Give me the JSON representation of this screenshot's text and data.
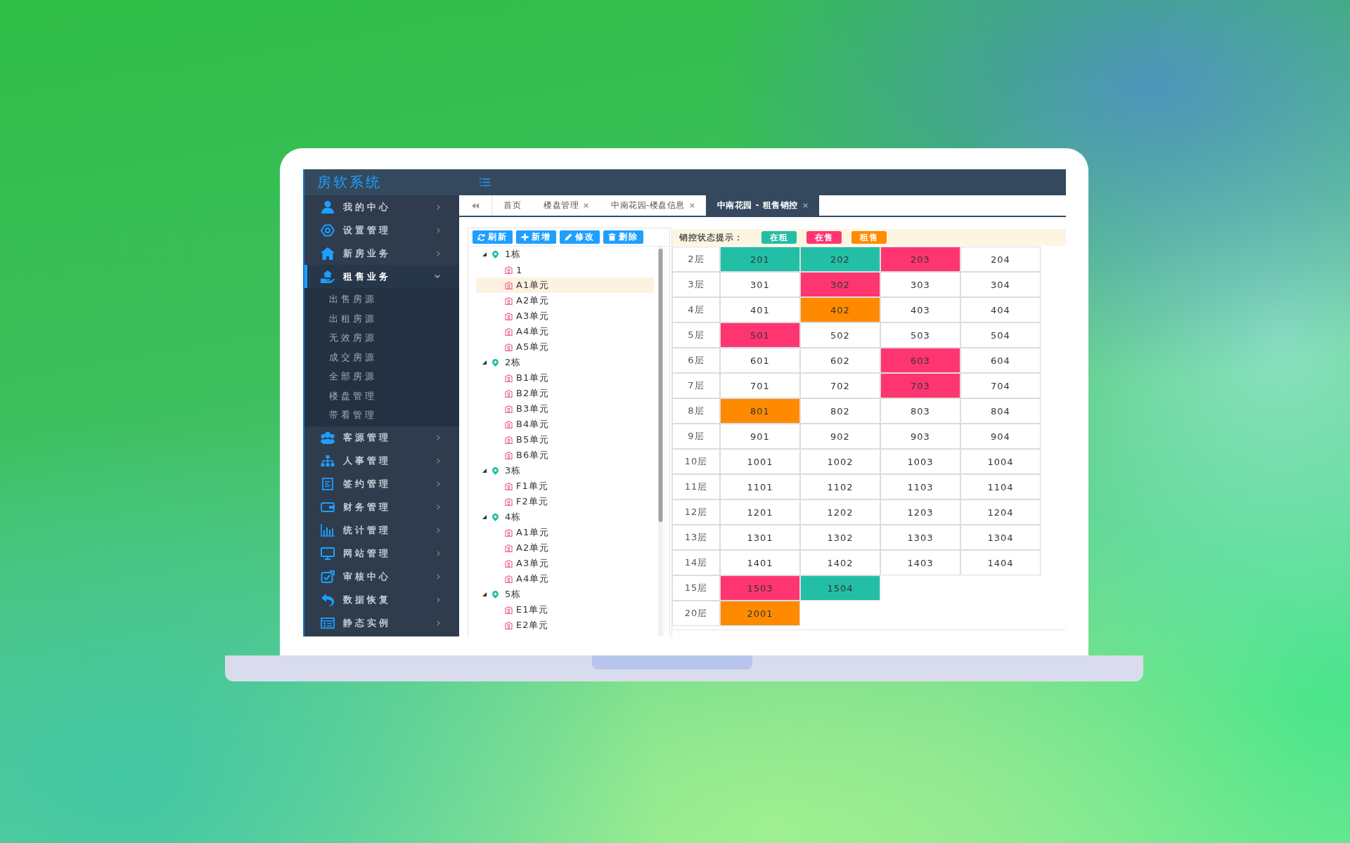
{
  "header": {
    "title": "房软系统"
  },
  "sidebar": {
    "items": [
      {
        "label": "我的中心",
        "selected": false,
        "expanded": false
      },
      {
        "label": "设置管理",
        "selected": false,
        "expanded": false
      },
      {
        "label": "新房业务",
        "selected": false,
        "expanded": false
      },
      {
        "label": "租售业务",
        "selected": true,
        "expanded": true,
        "children": [
          {
            "label": "出售房源",
            "selected": false
          },
          {
            "label": "出租房源",
            "selected": false
          },
          {
            "label": "无效房源",
            "selected": false
          },
          {
            "label": "成交房源",
            "selected": false
          },
          {
            "label": "全部房源",
            "selected": false
          },
          {
            "label": "楼盘管理",
            "selected": false
          },
          {
            "label": "带看管理",
            "selected": false
          }
        ]
      },
      {
        "label": "客源管理",
        "selected": false,
        "expanded": false
      },
      {
        "label": "人事管理",
        "selected": false,
        "expanded": false
      },
      {
        "label": "签约管理",
        "selected": false,
        "expanded": false
      },
      {
        "label": "财务管理",
        "selected": false,
        "expanded": false
      },
      {
        "label": "统计管理",
        "selected": false,
        "expanded": false
      },
      {
        "label": "网站管理",
        "selected": false,
        "expanded": false
      },
      {
        "label": "审核中心",
        "selected": false,
        "expanded": false
      },
      {
        "label": "数据恢复",
        "selected": false,
        "expanded": false
      },
      {
        "label": "静态实例",
        "selected": false,
        "expanded": false
      }
    ]
  },
  "tabs": [
    {
      "label": "首页",
      "selected": false,
      "closable": false
    },
    {
      "label": "楼盘管理",
      "selected": false,
      "closable": true
    },
    {
      "label": "中南花园-楼盘信息",
      "selected": false,
      "closable": true
    },
    {
      "label": "中南花园 - 租售销控",
      "selected": true,
      "closable": true
    }
  ],
  "toolbar": {
    "buttons": [
      "刷新",
      "新增",
      "修改",
      "删除"
    ]
  },
  "tree": [
    {
      "label": "1栋",
      "selected": false,
      "expanded": true,
      "children": [
        {
          "label": "1",
          "selected": false
        },
        {
          "label": "A1单元",
          "selected": true
        },
        {
          "label": "A2单元",
          "selected": false
        },
        {
          "label": "A3单元",
          "selected": false
        },
        {
          "label": "A4单元",
          "selected": false
        },
        {
          "label": "A5单元",
          "selected": false
        }
      ]
    },
    {
      "label": "2栋",
      "selected": false,
      "expanded": true,
      "children": [
        {
          "label": "B1单元",
          "selected": false
        },
        {
          "label": "B2单元",
          "selected": false
        },
        {
          "label": "B3单元",
          "selected": false
        },
        {
          "label": "B4单元",
          "selected": false
        },
        {
          "label": "B5单元",
          "selected": false
        },
        {
          "label": "B6单元",
          "selected": false
        }
      ]
    },
    {
      "label": "3栋",
      "selected": false,
      "expanded": true,
      "children": [
        {
          "label": "F1单元",
          "selected": false
        },
        {
          "label": "F2单元",
          "selected": false
        }
      ]
    },
    {
      "label": "4栋",
      "selected": false,
      "expanded": true,
      "children": [
        {
          "label": "A1单元",
          "selected": false
        },
        {
          "label": "A2单元",
          "selected": false
        },
        {
          "label": "A3单元",
          "selected": false
        },
        {
          "label": "A4单元",
          "selected": false
        }
      ]
    },
    {
      "label": "5栋",
      "selected": false,
      "expanded": true,
      "children": [
        {
          "label": "E1单元",
          "selected": false
        },
        {
          "label": "E2单元",
          "selected": false
        }
      ]
    }
  ],
  "legend": {
    "label": "销控状态提示：",
    "statuses": [
      {
        "label": "在租",
        "color": "#22bfa6"
      },
      {
        "label": "在售",
        "color": "#ff3572"
      },
      {
        "label": "租售",
        "color": "#ff8a00"
      }
    ]
  },
  "grid": {
    "floors": [
      {
        "label": "2层",
        "rooms": [
          {
            "number": "201",
            "color": "#22bfa6"
          },
          {
            "number": "202",
            "color": "#22bfa6"
          },
          {
            "number": "203",
            "color": "#ff3572"
          },
          {
            "number": "204"
          }
        ]
      },
      {
        "label": "3层",
        "rooms": [
          {
            "number": "301"
          },
          {
            "number": "302",
            "color": "#ff3572"
          },
          {
            "number": "303"
          },
          {
            "number": "304"
          }
        ]
      },
      {
        "label": "4层",
        "rooms": [
          {
            "number": "401"
          },
          {
            "number": "402",
            "color": "#ff8a00"
          },
          {
            "number": "403"
          },
          {
            "number": "404"
          }
        ]
      },
      {
        "label": "5层",
        "rooms": [
          {
            "number": "501",
            "color": "#ff3572"
          },
          {
            "number": "502"
          },
          {
            "number": "503"
          },
          {
            "number": "504"
          }
        ]
      },
      {
        "label": "6层",
        "rooms": [
          {
            "number": "601"
          },
          {
            "number": "602"
          },
          {
            "number": "603",
            "color": "#ff3572"
          },
          {
            "number": "604"
          }
        ]
      },
      {
        "label": "7层",
        "rooms": [
          {
            "number": "701"
          },
          {
            "number": "702"
          },
          {
            "number": "703",
            "color": "#ff3572"
          },
          {
            "number": "704"
          }
        ]
      },
      {
        "label": "8层",
        "rooms": [
          {
            "number": "801",
            "color": "#ff8a00"
          },
          {
            "number": "802"
          },
          {
            "number": "803"
          },
          {
            "number": "804"
          }
        ]
      },
      {
        "label": "9层",
        "rooms": [
          {
            "number": "901"
          },
          {
            "number": "902"
          },
          {
            "number": "903"
          },
          {
            "number": "904"
          }
        ]
      },
      {
        "label": "10层",
        "rooms": [
          {
            "number": "1001"
          },
          {
            "number": "1002"
          },
          {
            "number": "1003"
          },
          {
            "number": "1004"
          }
        ]
      },
      {
        "label": "11层",
        "rooms": [
          {
            "number": "1101"
          },
          {
            "number": "1102"
          },
          {
            "number": "1103"
          },
          {
            "number": "1104"
          }
        ]
      },
      {
        "label": "12层",
        "rooms": [
          {
            "number": "1201"
          },
          {
            "number": "1202"
          },
          {
            "number": "1203"
          },
          {
            "number": "1204"
          }
        ]
      },
      {
        "label": "13层",
        "rooms": [
          {
            "number": "1301"
          },
          {
            "number": "1302"
          },
          {
            "number": "1303"
          },
          {
            "number": "1304"
          }
        ]
      },
      {
        "label": "14层",
        "rooms": [
          {
            "number": "1401"
          },
          {
            "number": "1402"
          },
          {
            "number": "1403"
          },
          {
            "number": "1404"
          }
        ]
      },
      {
        "label": "15层",
        "rooms": [
          {
            "number": "1503",
            "color": "#ff3572"
          },
          {
            "number": "1504",
            "color": "#22bfa6"
          }
        ]
      },
      {
        "label": "20层",
        "rooms": [
          {
            "number": "2001",
            "color": "#ff8a00"
          }
        ]
      }
    ]
  }
}
